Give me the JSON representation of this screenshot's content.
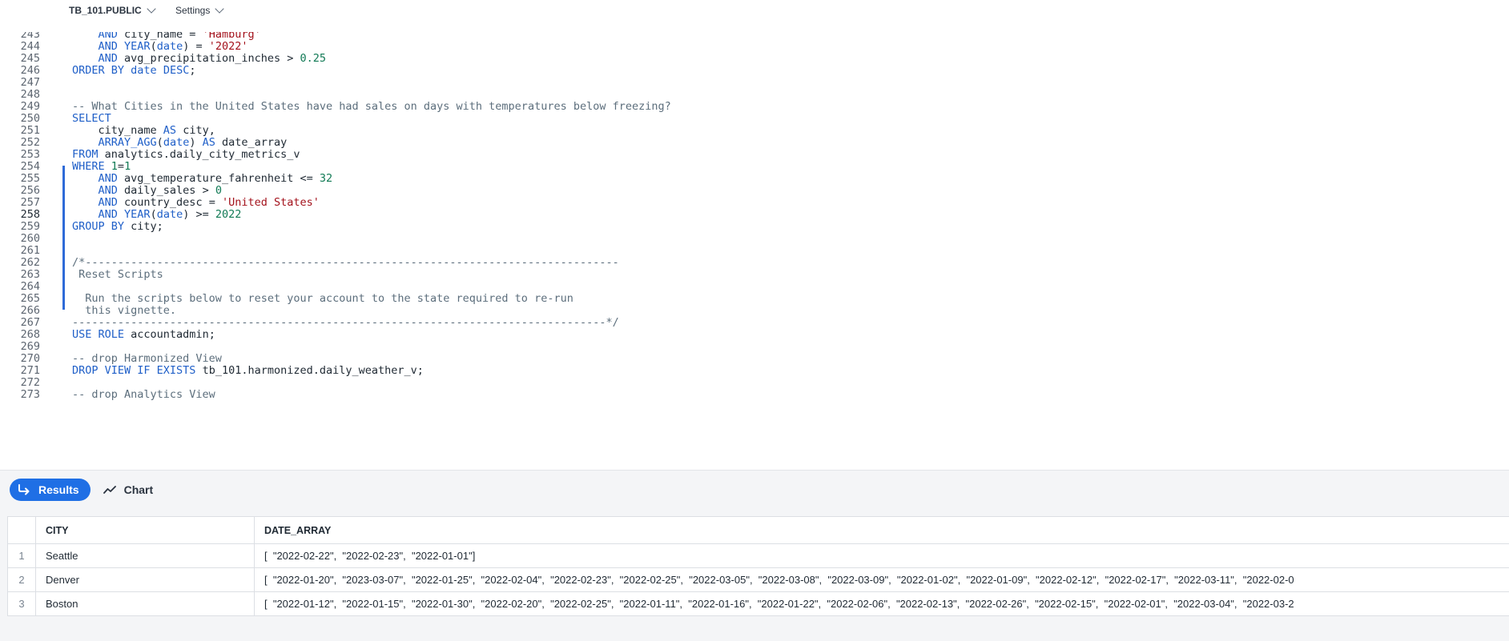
{
  "context": {
    "database": "TB_101.PUBLIC",
    "settings_label": "Settings"
  },
  "editor": {
    "lines": [
      {
        "n": "243",
        "segs": [
          [
            "    ",
            ""
          ],
          [
            "AND",
            "kw"
          ],
          [
            " city_name = ",
            ""
          ],
          [
            "'Hamburg'",
            "st"
          ]
        ]
      },
      {
        "n": "244",
        "segs": [
          [
            "    ",
            ""
          ],
          [
            "AND",
            "kw"
          ],
          [
            " ",
            ""
          ],
          [
            "YEAR",
            "fn"
          ],
          [
            "(",
            ""
          ],
          [
            "date",
            "kw"
          ],
          [
            ") = ",
            ""
          ],
          [
            "'2022'",
            "st"
          ]
        ]
      },
      {
        "n": "245",
        "segs": [
          [
            "    ",
            ""
          ],
          [
            "AND",
            "kw"
          ],
          [
            " avg_precipitation_inches > ",
            ""
          ],
          [
            "0.25",
            "nm"
          ]
        ]
      },
      {
        "n": "246",
        "segs": [
          [
            "ORDER BY",
            "kw"
          ],
          [
            " ",
            ""
          ],
          [
            "date",
            "kw"
          ],
          [
            " ",
            ""
          ],
          [
            "DESC",
            "kw"
          ],
          [
            ";",
            ""
          ]
        ]
      },
      {
        "n": "247",
        "segs": []
      },
      {
        "n": "248",
        "segs": []
      },
      {
        "n": "249",
        "segs": [
          [
            "-- What Cities in the United States have had sales on days with temperatures below freezing?",
            "cm"
          ]
        ]
      },
      {
        "n": "250",
        "segs": [
          [
            "SELECT",
            "kw"
          ]
        ]
      },
      {
        "n": "251",
        "segs": [
          [
            "    city_name ",
            ""
          ],
          [
            "AS",
            "kw"
          ],
          [
            " city,",
            ""
          ]
        ]
      },
      {
        "n": "252",
        "segs": [
          [
            "    ",
            ""
          ],
          [
            "ARRAY_AGG",
            "fn"
          ],
          [
            "(",
            ""
          ],
          [
            "date",
            "kw"
          ],
          [
            ") ",
            ""
          ],
          [
            "AS",
            "kw"
          ],
          [
            " date_array",
            ""
          ]
        ]
      },
      {
        "n": "253",
        "segs": [
          [
            "FROM",
            "kw"
          ],
          [
            " analytics.daily_city_metrics_v",
            ""
          ]
        ]
      },
      {
        "n": "254",
        "segs": [
          [
            "WHERE",
            "kw"
          ],
          [
            " ",
            ""
          ],
          [
            "1",
            "nm"
          ],
          [
            "=",
            ""
          ],
          [
            "1",
            "nm"
          ]
        ]
      },
      {
        "n": "255",
        "segs": [
          [
            "    ",
            ""
          ],
          [
            "AND",
            "kw"
          ],
          [
            " avg_temperature_fahrenheit <= ",
            ""
          ],
          [
            "32",
            "nm"
          ]
        ]
      },
      {
        "n": "256",
        "segs": [
          [
            "    ",
            ""
          ],
          [
            "AND",
            "kw"
          ],
          [
            " daily_sales > ",
            ""
          ],
          [
            "0",
            "nm"
          ]
        ]
      },
      {
        "n": "257",
        "segs": [
          [
            "    ",
            ""
          ],
          [
            "AND",
            "kw"
          ],
          [
            " country_desc = ",
            ""
          ],
          [
            "'United States'",
            "st"
          ]
        ]
      },
      {
        "n": "258",
        "segs": [
          [
            "    ",
            ""
          ],
          [
            "AND",
            "kw"
          ],
          [
            " ",
            ""
          ],
          [
            "YEAR",
            "fn"
          ],
          [
            "(",
            ""
          ],
          [
            "date",
            "kw"
          ],
          [
            ") >= ",
            ""
          ],
          [
            "2022",
            "nm"
          ]
        ],
        "current": true
      },
      {
        "n": "259",
        "segs": [
          [
            "GROUP BY",
            "kw"
          ],
          [
            " city;",
            ""
          ]
        ]
      },
      {
        "n": "260",
        "segs": []
      },
      {
        "n": "261",
        "segs": []
      },
      {
        "n": "262",
        "segs": [
          [
            "/*----------------------------------------------------------------------------------",
            "cm"
          ]
        ]
      },
      {
        "n": "263",
        "segs": [
          [
            " Reset Scripts",
            "cm"
          ]
        ]
      },
      {
        "n": "264",
        "segs": []
      },
      {
        "n": "265",
        "segs": [
          [
            "  Run the scripts below to reset your account to the state required to re-run",
            "cm"
          ]
        ]
      },
      {
        "n": "266",
        "segs": [
          [
            "  this vignette.",
            "cm"
          ]
        ]
      },
      {
        "n": "267",
        "segs": [
          [
            "----------------------------------------------------------------------------------*/",
            "cm"
          ]
        ]
      },
      {
        "n": "268",
        "segs": [
          [
            "USE ROLE",
            "kw"
          ],
          [
            " accountadmin;",
            ""
          ]
        ]
      },
      {
        "n": "269",
        "segs": []
      },
      {
        "n": "270",
        "segs": [
          [
            "-- drop Harmonized View",
            "cm"
          ]
        ]
      },
      {
        "n": "271",
        "segs": [
          [
            "DROP VIEW IF EXISTS",
            "kw"
          ],
          [
            " tb_101.harmonized.daily_weather_v;",
            ""
          ]
        ]
      },
      {
        "n": "272",
        "segs": []
      },
      {
        "n": "273",
        "segs": [
          [
            "-- drop Analytics View",
            "cm"
          ]
        ]
      }
    ]
  },
  "results": {
    "tab_results": "Results",
    "tab_chart": "Chart",
    "columns": [
      "CITY",
      "DATE_ARRAY"
    ],
    "rows": [
      {
        "idx": "1",
        "city": "Seattle",
        "dates": "[  \"2022-02-22\",  \"2022-02-23\",  \"2022-01-01\"]"
      },
      {
        "idx": "2",
        "city": "Denver",
        "dates": "[  \"2022-01-20\",  \"2023-03-07\",  \"2022-01-25\",  \"2022-02-04\",  \"2022-02-23\",  \"2022-02-25\",  \"2022-03-05\",  \"2022-03-08\",  \"2022-03-09\",  \"2022-01-02\",  \"2022-01-09\",  \"2022-02-12\",  \"2022-02-17\",  \"2022-03-11\",  \"2022-02-0"
      },
      {
        "idx": "3",
        "city": "Boston",
        "dates": "[  \"2022-01-12\",  \"2022-01-15\",  \"2022-01-30\",  \"2022-02-20\",  \"2022-02-25\",  \"2022-01-11\",  \"2022-01-16\",  \"2022-01-22\",  \"2022-02-06\",  \"2022-02-13\",  \"2022-02-26\",  \"2022-02-15\",  \"2022-02-01\",  \"2022-03-04\",  \"2022-03-2"
      }
    ]
  }
}
